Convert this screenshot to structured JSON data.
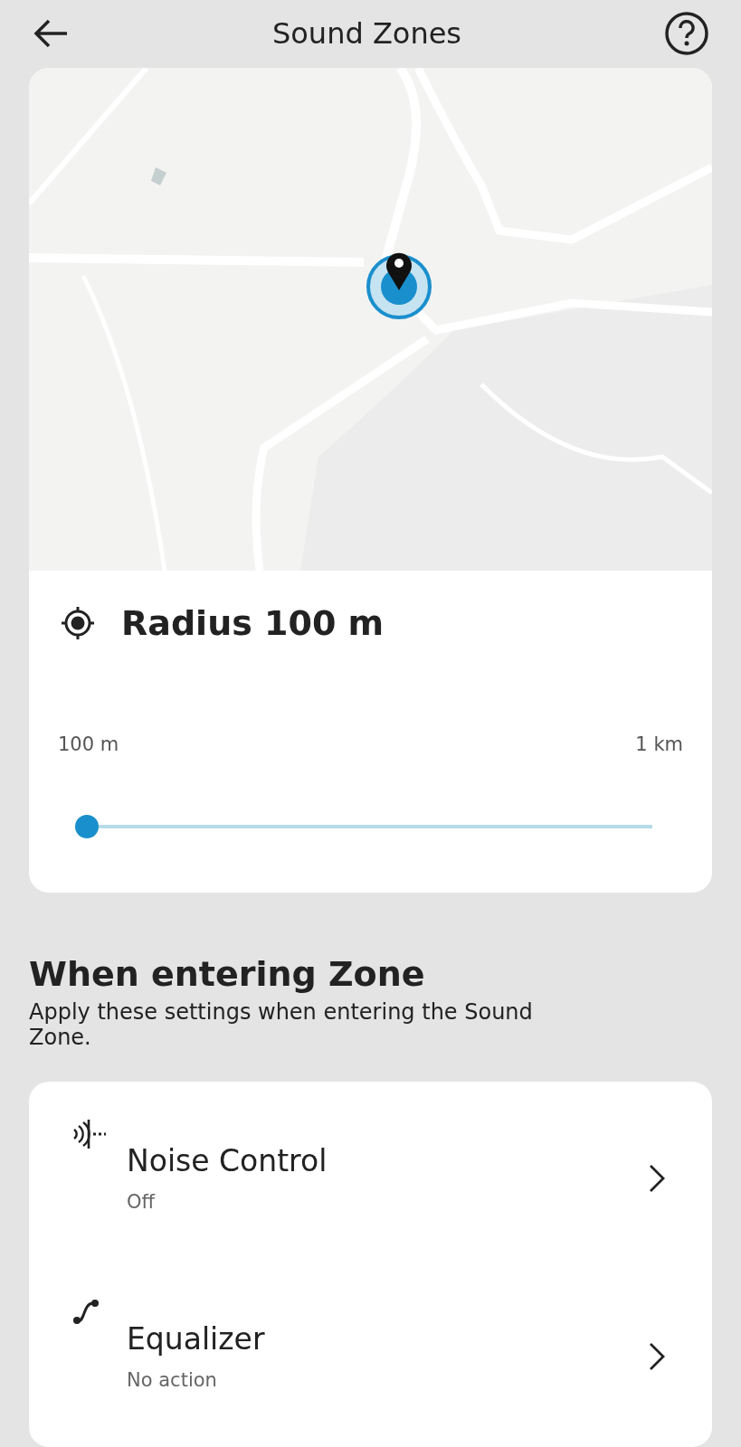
{
  "header": {
    "title": "Sound Zones"
  },
  "radius": {
    "title": "Radius 100 m",
    "min_label": "100 m",
    "max_label": "1 km",
    "level": 0
  },
  "section": {
    "title": "When entering Zone",
    "description": "Apply these settings when entering the Sound Zone."
  },
  "settings": [
    {
      "kind": "noise",
      "label": "Noise Control",
      "value": "Off"
    },
    {
      "kind": "equalizer",
      "label": "Equalizer",
      "value": "No action"
    }
  ]
}
